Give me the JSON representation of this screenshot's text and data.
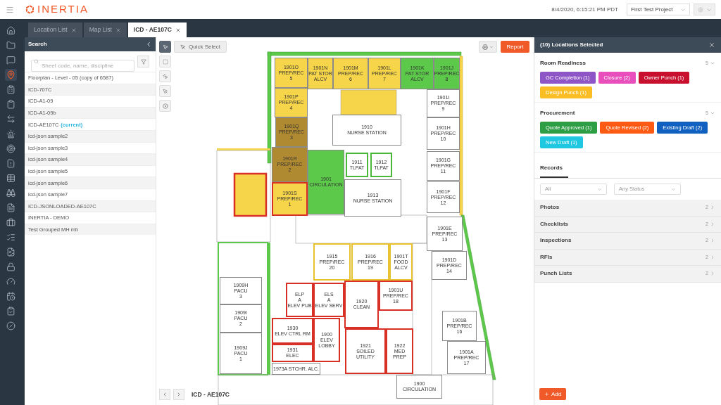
{
  "header": {
    "logo": "INERTIA",
    "datetime": "8/4/2020, 6:15:21 PM PDT",
    "project": "First Test Project"
  },
  "nav": [
    {
      "selected": false
    },
    {
      "selected": false
    },
    {
      "selected": false
    },
    {
      "selected": true
    },
    {
      "selected": false
    },
    {
      "selected": false
    },
    {
      "selected": false
    },
    {
      "selected": false
    },
    {
      "selected": false
    },
    {
      "selected": false
    },
    {
      "selected": false
    },
    {
      "selected": false
    },
    {
      "selected": false
    },
    {
      "selected": false
    },
    {
      "selected": false
    },
    {
      "selected": false
    },
    {
      "selected": false
    },
    {
      "selected": false
    },
    {
      "selected": false
    },
    {
      "selected": false
    },
    {
      "selected": false
    }
  ],
  "tabs": [
    {
      "label": "Location List",
      "selected": false
    },
    {
      "label": "Map List",
      "selected": false
    },
    {
      "label": "ICD - AE107C",
      "selected": true
    }
  ],
  "search": {
    "title": "Search",
    "placeholder": "Sheet code, name, discipline",
    "items": [
      {
        "label": "Floorplan - Level - 05 (copy of 6587)"
      },
      {
        "label": "ICD-707C"
      },
      {
        "label": "ICD-A1-09"
      },
      {
        "label": "ICD-A1-09b"
      },
      {
        "label": "ICD-AE107C",
        "badge": "(current)"
      },
      {
        "label": "icd-json sample2"
      },
      {
        "label": "icd-json sample3"
      },
      {
        "label": "icd-json sample4"
      },
      {
        "label": "icd-json sample5"
      },
      {
        "label": "icd-json sample6"
      },
      {
        "label": "icd-json sample7"
      },
      {
        "label": "ICD-JSONLOADED-AE107C"
      },
      {
        "label": "INERTIA - DEMO"
      },
      {
        "label": "Test Grouped MH mh"
      }
    ]
  },
  "map": {
    "tools": [
      {
        "selected": true
      },
      {
        "selected": false
      },
      {
        "selected": false
      },
      {
        "selected": false
      },
      {
        "selected": false
      }
    ],
    "quick_select": "Quick Select",
    "report": "Report",
    "sheet_label": "ICD - AE107C",
    "rooms": [
      {
        "lines": [
          "1901O",
          "PREP/REC",
          "5"
        ],
        "color": "#f7d54a",
        "kind": "plain"
      },
      {
        "lines": [
          "1901N",
          "PAT STOR",
          "ALCV"
        ],
        "color": "#f7d54a",
        "kind": "plain"
      },
      {
        "lines": [
          "1901M",
          "PREP/REC",
          "6"
        ],
        "color": "#f7d54a",
        "kind": "plain"
      },
      {
        "lines": [
          "1901L",
          "PREP/REC",
          "7"
        ],
        "color": "#f7d54a",
        "kind": "plain"
      },
      {
        "lines": [
          "1901K",
          "PAT STOR",
          "ALCV"
        ],
        "color": "#5cc94a",
        "kind": "plain"
      },
      {
        "lines": [
          "1901J",
          "PREP/REC",
          "8"
        ],
        "color": "#5cc94a",
        "kind": "plain"
      },
      {
        "lines": [
          "1901P",
          "PREP/REC",
          "4"
        ],
        "color": "#f7d54a",
        "kind": "plain"
      },
      {
        "lines": [
          "1901I",
          "PREP/REC",
          "9"
        ],
        "color": "#ffffff",
        "kind": "plain"
      },
      {
        "lines": [
          "1901Q",
          "PREP/REC",
          "3"
        ],
        "color": "#b08a30",
        "kind": "plain"
      },
      {
        "lines": [
          "1910",
          "NURSE STATION"
        ],
        "color": "#ffffff",
        "kind": "plain"
      },
      {
        "lines": [
          "1901H",
          "PREP/REC",
          "10"
        ],
        "color": "#ffffff",
        "kind": "plain"
      },
      {
        "lines": [
          "1901R",
          "PREP/REC",
          "2"
        ],
        "color": "#b08a30",
        "kind": "plain"
      },
      {
        "lines": [
          "1901",
          "CIRCULATION"
        ],
        "color": "#5cc94a",
        "kind": "plain"
      },
      {
        "lines": [
          "1911",
          "TLPAT"
        ],
        "color": "#ffffff",
        "kind": "done"
      },
      {
        "lines": [
          "1912",
          "TLPAT"
        ],
        "color": "#ffffff",
        "kind": "done"
      },
      {
        "lines": [
          "1901G",
          "PREP/REC",
          "11"
        ],
        "color": "#ffffff",
        "kind": "plain"
      },
      {
        "lines": [
          "1901S",
          "PREP/REC",
          "1"
        ],
        "color": "#f7d54a",
        "kind": "flagged"
      },
      {
        "lines": [
          "1913",
          "NURSE STATION"
        ],
        "color": "#ffffff",
        "kind": "plain"
      },
      {
        "lines": [
          "1901F",
          "PREP/REC",
          "12"
        ],
        "color": "#ffffff",
        "kind": "plain"
      },
      {
        "lines": [
          "1901E",
          "PREP/REC",
          "13"
        ],
        "color": "#ffffff",
        "kind": "plain"
      },
      {
        "lines": [
          "1901D",
          "PREP/REC",
          "14"
        ],
        "color": "#ffffff",
        "kind": "plain"
      },
      {
        "lines": [
          "1915",
          "PREP/REC",
          "20"
        ],
        "color": "#ffffff",
        "kind": "pending"
      },
      {
        "lines": [
          "1916",
          "PREP/REC",
          "19"
        ],
        "color": "#ffffff",
        "kind": "pending"
      },
      {
        "lines": [
          "1901T",
          "FOOD",
          "ALCV"
        ],
        "color": "#ffffff",
        "kind": "pending"
      },
      {
        "lines": [
          "1909H",
          "PACU",
          "3"
        ],
        "color": "#ffffff",
        "kind": "plain"
      },
      {
        "lines": [
          "ELP",
          "A",
          "ELEV PUB"
        ],
        "color": "#ffffff",
        "kind": "flagged"
      },
      {
        "lines": [
          "ELS",
          "A",
          "ELEV SERV"
        ],
        "color": "#ffffff",
        "kind": "flagged"
      },
      {
        "lines": [
          "1920",
          "CLEAN"
        ],
        "color": "#ffffff",
        "kind": "flagged"
      },
      {
        "lines": [
          "1901U",
          "PREP/REC",
          "18"
        ],
        "color": "#ffffff",
        "kind": "flagged"
      },
      {
        "lines": [
          "1901B",
          "PREP/REC",
          "16"
        ],
        "color": "#ffffff",
        "kind": "plain"
      },
      {
        "lines": [
          "1909I",
          "PACU",
          "2"
        ],
        "color": "#ffffff",
        "kind": "plain"
      },
      {
        "lines": [
          "1909J",
          "PACU",
          "1"
        ],
        "color": "#ffffff",
        "kind": "plain"
      },
      {
        "lines": [
          "1930",
          "ELEV CTRL RM"
        ],
        "color": "#ffffff",
        "kind": "flagged"
      },
      {
        "lines": [
          "1931",
          "ELEC"
        ],
        "color": "#ffffff",
        "kind": "flagged"
      },
      {
        "lines": [
          "1900",
          "ELEV",
          "LOBBY"
        ],
        "color": "#ffffff",
        "kind": "flagged"
      },
      {
        "lines": [
          "1921",
          "SOILED",
          "UTILITY"
        ],
        "color": "#ffffff",
        "kind": "flagged"
      },
      {
        "lines": [
          "1922",
          "MED",
          "PREP"
        ],
        "color": "#ffffff",
        "kind": "flagged"
      },
      {
        "lines": [
          "1901A",
          "PREP/REC",
          "17"
        ],
        "color": "#ffffff",
        "kind": "plain"
      },
      {
        "lines": [
          "1973A STCHR. ALC."
        ],
        "color": "#ffffff",
        "kind": "plain"
      },
      {
        "lines": [
          "1900",
          "CIRCULATION"
        ],
        "color": "#ffffff",
        "kind": "plain"
      }
    ]
  },
  "panel": {
    "title": "(10) Locations Selected",
    "groups": [
      {
        "title": "Room Readiness",
        "count": "5",
        "tags": [
          {
            "label": "GC Completion (1)",
            "color": "#8e55c7"
          },
          {
            "label": "Closure (2)",
            "color": "#e84fbd"
          },
          {
            "label": "Owner Punch (1)",
            "color": "#c8102e"
          },
          {
            "label": "Design Punch (1)",
            "color": "#fbbd24"
          }
        ]
      },
      {
        "title": "Procurement",
        "count": "5",
        "tags": [
          {
            "label": "Quote Approved (1)",
            "color": "#2e9e44"
          },
          {
            "label": "Quote Revised (2)",
            "color": "#ff5a14"
          },
          {
            "label": "Existing Draft (2)",
            "color": "#1060bf"
          },
          {
            "label": "New Draft (1)",
            "color": "#1fc7e0"
          }
        ]
      }
    ],
    "records_tab": {
      "label": "Records",
      "selected": true
    },
    "filters": [
      {
        "value": "All"
      },
      {
        "value": "Any Status"
      }
    ],
    "records": [
      {
        "label": "Photos",
        "count": "2"
      },
      {
        "label": "Checklists",
        "count": "2"
      },
      {
        "label": "Inspections",
        "count": "2"
      },
      {
        "label": "RFIs",
        "count": "2"
      },
      {
        "label": "Punch Lists",
        "count": "2"
      }
    ],
    "add": "Add"
  }
}
